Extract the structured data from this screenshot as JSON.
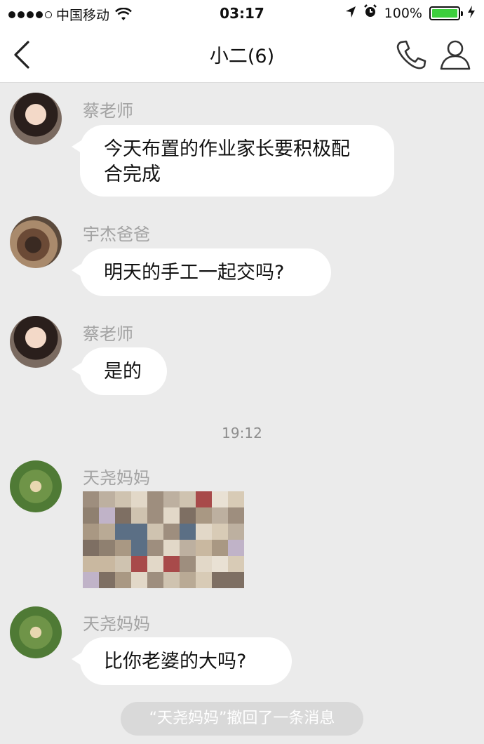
{
  "status_bar": {
    "carrier": "中国移动",
    "time": "03:17",
    "battery_percent": "100%",
    "battery_level": 1.0
  },
  "nav": {
    "title": "小二(6)",
    "back_icon": "chevron-left-icon",
    "call_icon": "phone-icon",
    "profile_icon": "person-icon"
  },
  "messages": [
    {
      "sender": "蔡老师",
      "text": "今天布置的作业家长要积极配\n合完成",
      "avatar": "teacher"
    },
    {
      "sender": "宇杰爸爸",
      "text": "明天的手工一起交吗?",
      "avatar": "dad"
    },
    {
      "sender": "蔡老师",
      "text": "是的",
      "avatar": "teacher"
    },
    {
      "sender": "天尧妈妈",
      "type": "image",
      "avatar": "mom"
    },
    {
      "sender": "天尧妈妈",
      "text": "比你老婆的大吗?",
      "avatar": "mom"
    }
  ],
  "timestamp": "19:12",
  "recall_notice": "“天尧妈妈”撤回了一条消息",
  "colors": {
    "background": "#ebebeb",
    "bubble": "#ffffff",
    "sender_name": "#a3a3a3",
    "battery_fill": "#3ccf3c"
  }
}
